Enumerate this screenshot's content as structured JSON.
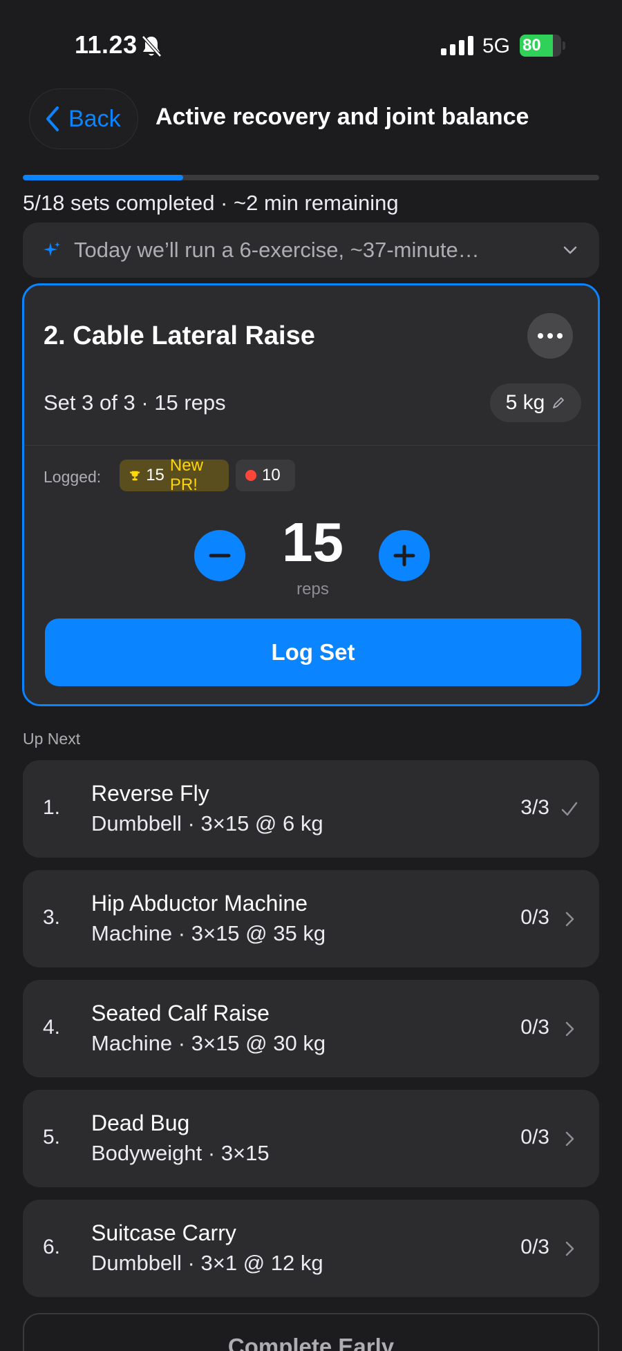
{
  "status_bar": {
    "time": "11.23",
    "network": "5G",
    "battery_level": 80,
    "battery_text": "80"
  },
  "header": {
    "back_label": "Back",
    "title": "Active recovery and joint balance"
  },
  "progress": {
    "fraction": 0.278,
    "text": "5/18 sets completed · ~2 min remaining"
  },
  "summary": {
    "text": "Today we’ll run a 6-exercise, ~37-minute…"
  },
  "active_exercise": {
    "title": "2. Cable Lateral Raise",
    "set_info": "Set 3 of 3 · 15 reps",
    "weight": "5 kg",
    "logged_label": "Logged:",
    "pr_value": "15",
    "pr_text": "New PR!",
    "previous_value": "10",
    "reps_value": "15",
    "reps_label": "reps",
    "log_button": "Log Set"
  },
  "up_next": {
    "label": "Up Next",
    "items": [
      {
        "index": "1.",
        "name": "Reverse Fly",
        "detail": "Dumbbell · 3×15 @ 6 kg",
        "count": "3/3",
        "status_icon": "checkmark-icon"
      },
      {
        "index": "3.",
        "name": "Hip Abductor Machine",
        "detail": "Machine · 3×15 @ 35 kg",
        "count": "0/3",
        "status_icon": "chevron-right-icon"
      },
      {
        "index": "4.",
        "name": "Seated Calf Raise",
        "detail": "Machine · 3×15 @ 30 kg",
        "count": "0/3",
        "status_icon": "chevron-right-icon"
      },
      {
        "index": "5.",
        "name": "Dead Bug",
        "detail": "Bodyweight · 3×15",
        "count": "0/3",
        "status_icon": "chevron-right-icon"
      },
      {
        "index": "6.",
        "name": "Suitcase Carry",
        "detail": "Dumbbell · 3×1 @ 12 kg",
        "count": "0/3",
        "status_icon": "chevron-right-icon"
      }
    ]
  },
  "complete_button": "Complete Early",
  "colors": {
    "accent": "#0a84ff",
    "background": "#1c1c1e",
    "card": "#2c2c2e",
    "pr_yellow": "#ffd60a",
    "battery_green": "#30d158"
  }
}
